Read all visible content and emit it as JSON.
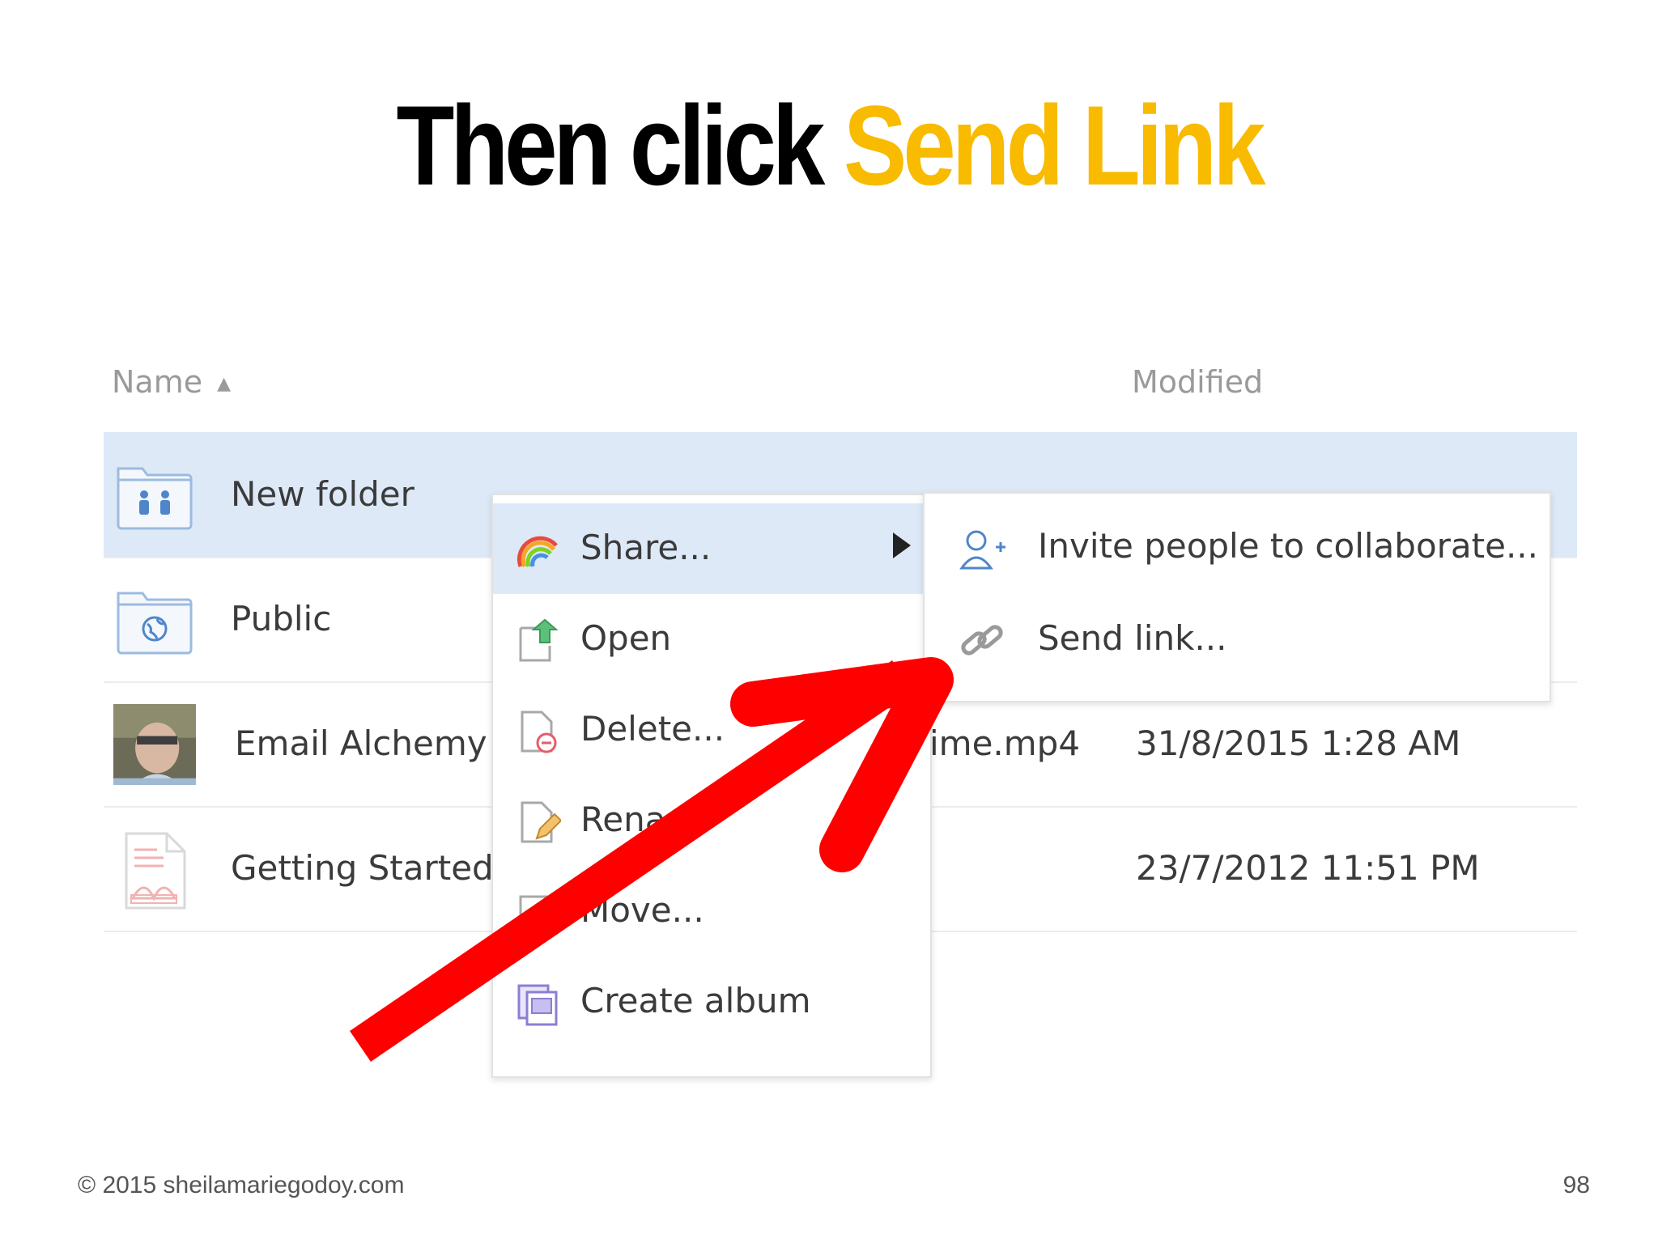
{
  "slide": {
    "title_prefix": "Then click ",
    "title_highlight": "Send Link",
    "footer_copyright": "© 2015 sheilamariegodoy.com",
    "page_number": "98"
  },
  "list": {
    "header_name": "Name",
    "header_sort_glyph": "▲",
    "header_modified": "Modified",
    "rows": [
      {
        "name": "New folder",
        "modified": "",
        "icon": "shared-folder-icon"
      },
      {
        "name": "Public",
        "modified": "",
        "icon": "public-folder-icon"
      },
      {
        "name": "Email Alchemy ",
        "name_suffix": "ime.mp4",
        "modified": "31/8/2015 1:28 AM",
        "icon": "video-thumbnail"
      },
      {
        "name": "Getting Started.",
        "modified": "23/7/2012 11:51 PM",
        "icon": "pdf-document-icon"
      }
    ]
  },
  "context_menu": {
    "items": [
      {
        "label": "Share...",
        "icon": "share-rainbow-icon",
        "has_submenu": true
      },
      {
        "label": "Open",
        "icon": "open-icon"
      },
      {
        "label": "Delete...",
        "icon": "delete-icon"
      },
      {
        "label": "Rena",
        "icon": "rename-icon"
      },
      {
        "label": "Move...",
        "icon": "move-icon"
      },
      {
        "label": "Create album",
        "icon": "create-album-icon"
      }
    ]
  },
  "submenu": {
    "items": [
      {
        "label": "Invite people to collaborate...",
        "icon": "add-person-icon"
      },
      {
        "label": "Send link...",
        "icon": "chain-link-icon"
      }
    ]
  },
  "colors": {
    "highlight": "#f8bb00",
    "selection": "#dde9f7",
    "annotation_arrow": "#ff0000"
  }
}
